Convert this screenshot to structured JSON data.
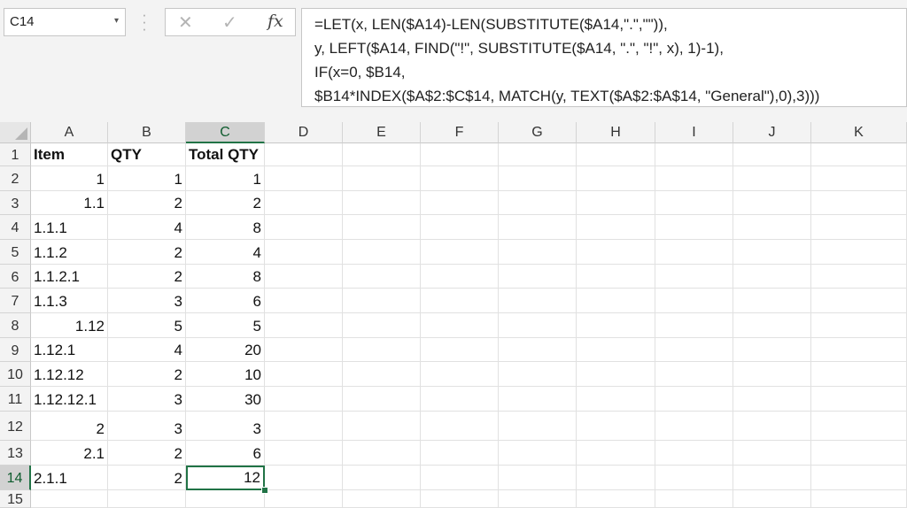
{
  "name_box": {
    "value": "C14"
  },
  "formula_bar": {
    "lines": [
      "=LET(x, LEN($A14)-LEN(SUBSTITUTE($A14,\".\",\"\")),",
      "y, LEFT($A14, FIND(\"!\", SUBSTITUTE($A14, \".\", \"!\", x), 1)-1),",
      "IF(x=0, $B14,",
      "$B14*INDEX($A$2:$C$14, MATCH(y, TEXT($A$2:$A$14, \"General\"),0),3)))"
    ]
  },
  "columns": [
    "A",
    "B",
    "C",
    "D",
    "E",
    "F",
    "G",
    "H",
    "I",
    "J",
    "K"
  ],
  "rows": [
    "1",
    "2",
    "3",
    "4",
    "5",
    "6",
    "7",
    "8",
    "9",
    "10",
    "11",
    "12",
    "13",
    "14",
    "15"
  ],
  "selected": {
    "col": "C",
    "row": "14"
  },
  "cells": {
    "header": [
      "Item",
      "QTY",
      "Total QTY"
    ],
    "data": [
      {
        "a": "1",
        "a_type": "num",
        "b": "1",
        "c": "1"
      },
      {
        "a": "1.1",
        "a_type": "num",
        "b": "2",
        "c": "2"
      },
      {
        "a": "1.1.1",
        "a_type": "txt",
        "b": "4",
        "c": "8"
      },
      {
        "a": "1.1.2",
        "a_type": "txt",
        "b": "2",
        "c": "4"
      },
      {
        "a": "1.1.2.1",
        "a_type": "txt",
        "b": "2",
        "c": "8"
      },
      {
        "a": "1.1.3",
        "a_type": "txt",
        "b": "3",
        "c": "6"
      },
      {
        "a": "1.12",
        "a_type": "num",
        "b": "5",
        "c": "5"
      },
      {
        "a": "1.12.1",
        "a_type": "txt",
        "b": "4",
        "c": "20"
      },
      {
        "a": "1.12.12",
        "a_type": "txt",
        "b": "2",
        "c": "10"
      },
      {
        "a": "1.12.12.1",
        "a_type": "txt",
        "b": "3",
        "c": "30"
      },
      {
        "a": "2",
        "a_type": "num",
        "b": "3",
        "c": "3"
      },
      {
        "a": "2.1",
        "a_type": "num",
        "b": "2",
        "c": "6"
      },
      {
        "a": "2.1.1",
        "a_type": "txt",
        "b": "2",
        "c": "12"
      }
    ]
  },
  "icons": {
    "cancel": "✕",
    "enter": "✓",
    "function": "fx",
    "dropdown": "▾"
  }
}
